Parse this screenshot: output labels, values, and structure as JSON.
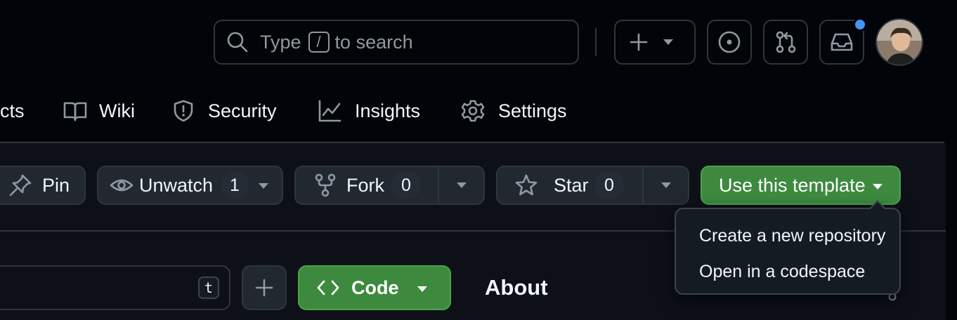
{
  "header": {
    "search": {
      "prefix": "Type",
      "key": "/",
      "suffix": "to search"
    },
    "notification_dot_color": "#4493f8"
  },
  "repo_nav": {
    "tabs": [
      {
        "label": "cts",
        "icon": "table-icon"
      },
      {
        "label": "Wiki",
        "icon": "book-icon"
      },
      {
        "label": "Security",
        "icon": "shield-icon"
      },
      {
        "label": "Insights",
        "icon": "graph-icon"
      },
      {
        "label": "Settings",
        "icon": "gear-icon"
      }
    ]
  },
  "actions": {
    "pin": "Pin",
    "unwatch": {
      "label": "Unwatch",
      "count": "1"
    },
    "fork": {
      "label": "Fork",
      "count": "0"
    },
    "star": {
      "label": "Star",
      "count": "0"
    },
    "use_template": "Use this template"
  },
  "template_menu": {
    "items": [
      "Create a new repository",
      "Open in a codespace"
    ]
  },
  "files": {
    "shortcut_key": "t",
    "code_button": "Code",
    "about_heading": "About"
  },
  "colors": {
    "background": "#010409",
    "border": "#30363d",
    "primary_button": "#238636",
    "text": "#f0f6fc",
    "muted_icon": "#9198a1"
  }
}
